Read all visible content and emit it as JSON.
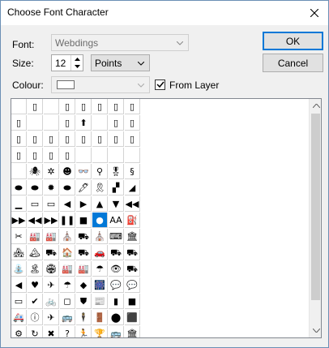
{
  "window": {
    "title": "Choose Font Character"
  },
  "font": {
    "label": "Font:",
    "value": "Webdings"
  },
  "size": {
    "label": "Size:",
    "value": "12",
    "unit": "Points"
  },
  "colour": {
    "label": "Colour:",
    "from_layer_label": "From Layer",
    "from_layer_checked": true
  },
  "buttons": {
    "ok": "OK",
    "cancel": "Cancel"
  },
  "grid": {
    "selected": "● (row 8, col 6)",
    "rows": [
      [
        "",
        "▯",
        "",
        "▯",
        "▯",
        "▯",
        "▯",
        "▯"
      ],
      [
        "▯",
        "",
        "",
        "▯",
        "⬆",
        "",
        "▯",
        "▯"
      ],
      [
        "▯",
        "▯",
        "▯",
        "▯",
        "▯",
        "▯",
        "▯",
        "▯"
      ],
      [
        "▯",
        "▯",
        "▯",
        "▯",
        "",
        "",
        "",
        ""
      ],
      [
        "",
        "🕷",
        "✲",
        "☻",
        "👓",
        "⚲",
        "🎖",
        "§"
      ],
      [
        "⬬",
        "⬬",
        "✹",
        "⬬",
        "🖊",
        "🎗",
        "▞",
        "◢"
      ],
      [
        "▁",
        "▭",
        "▭",
        "◀",
        "▶",
        "▲",
        "▼",
        "◀◀"
      ],
      [
        "▶▶",
        "◀◀",
        "▶▶",
        "❚❚",
        "■",
        "●",
        "AA",
        "⛽"
      ],
      [
        "✂",
        "🏭",
        "🏭",
        "⛪",
        "⛟",
        "⛪",
        "⌨",
        "🏛"
      ],
      [
        "🏘",
        "🏔",
        "⛟",
        "🏠",
        "⛟",
        "🚗",
        "⛟",
        "⛟"
      ],
      [
        "⛲",
        "🏝",
        "🏟",
        "🏭",
        "🏭",
        "☂",
        "👁",
        "⛟"
      ],
      [
        "◀",
        "♥",
        "✈",
        "☂",
        "◆",
        "🎆",
        "💬",
        "💬"
      ],
      [
        "▭",
        "✔",
        "🚲",
        "◻",
        "⛊",
        "📰",
        "▮",
        "■"
      ],
      [
        "🚑",
        "ⓘ",
        "✈",
        "🚌",
        "🕴",
        "🚪",
        "⬤",
        "⬛"
      ],
      [
        "⚙",
        "↻",
        "✖",
        "?",
        "🏃",
        "🏆",
        "🚌",
        "🏛"
      ]
    ]
  }
}
